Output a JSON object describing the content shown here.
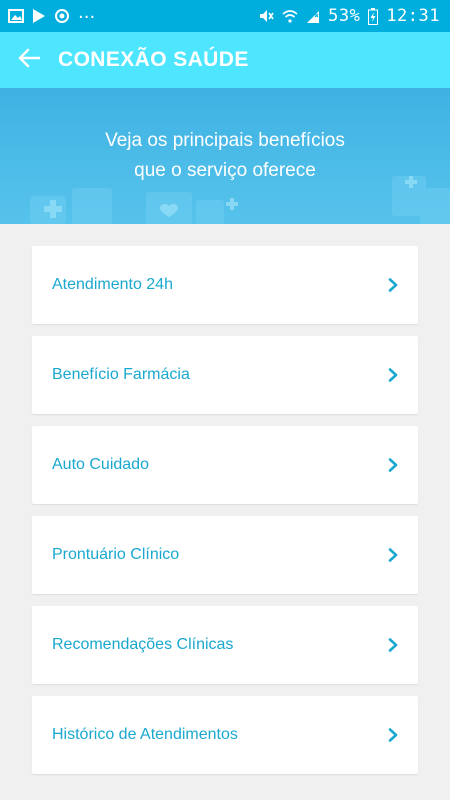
{
  "status_bar": {
    "left_icons": [
      "image-icon",
      "play-store-icon",
      "sync-icon"
    ],
    "overflow": "...",
    "battery_percent": "53%",
    "time": "12:31"
  },
  "app_bar": {
    "back_icon": "arrow-left-icon",
    "title": "CONEXÃO SAÚDE"
  },
  "banner": {
    "line1": "Veja os principais benefícios",
    "line2": "que o serviço oferece"
  },
  "menu": {
    "items": [
      {
        "label": "Atendimento 24h"
      },
      {
        "label": "Benefício Farmácia"
      },
      {
        "label": "Auto Cuidado"
      },
      {
        "label": "Prontuário Clínico"
      },
      {
        "label": "Recomendações Clínicas"
      },
      {
        "label": "Histórico de Atendimentos"
      }
    ],
    "chevron_icon": "chevron-right-icon"
  },
  "colors": {
    "status_bar": "#00aede",
    "app_bar": "#4ee6ff",
    "banner": "#49b9e7",
    "item_text": "#1aa8cf",
    "background": "#f0f0f0"
  }
}
